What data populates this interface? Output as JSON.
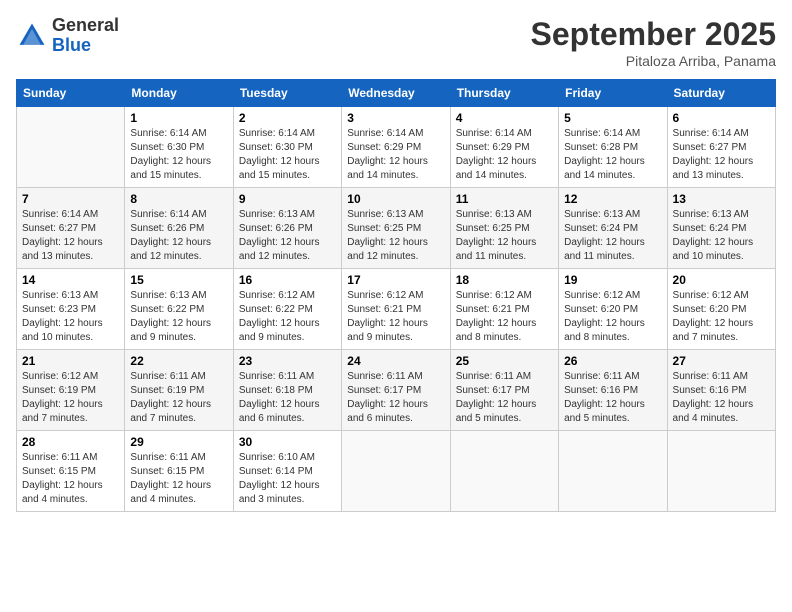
{
  "header": {
    "logo_general": "General",
    "logo_blue": "Blue",
    "month_title": "September 2025",
    "location": "Pitaloza Arriba, Panama"
  },
  "days_of_week": [
    "Sunday",
    "Monday",
    "Tuesday",
    "Wednesday",
    "Thursday",
    "Friday",
    "Saturday"
  ],
  "weeks": [
    [
      {
        "day": "",
        "sunrise": "",
        "sunset": "",
        "daylight": ""
      },
      {
        "day": "1",
        "sunrise": "Sunrise: 6:14 AM",
        "sunset": "Sunset: 6:30 PM",
        "daylight": "Daylight: 12 hours and 15 minutes."
      },
      {
        "day": "2",
        "sunrise": "Sunrise: 6:14 AM",
        "sunset": "Sunset: 6:30 PM",
        "daylight": "Daylight: 12 hours and 15 minutes."
      },
      {
        "day": "3",
        "sunrise": "Sunrise: 6:14 AM",
        "sunset": "Sunset: 6:29 PM",
        "daylight": "Daylight: 12 hours and 14 minutes."
      },
      {
        "day": "4",
        "sunrise": "Sunrise: 6:14 AM",
        "sunset": "Sunset: 6:29 PM",
        "daylight": "Daylight: 12 hours and 14 minutes."
      },
      {
        "day": "5",
        "sunrise": "Sunrise: 6:14 AM",
        "sunset": "Sunset: 6:28 PM",
        "daylight": "Daylight: 12 hours and 14 minutes."
      },
      {
        "day": "6",
        "sunrise": "Sunrise: 6:14 AM",
        "sunset": "Sunset: 6:27 PM",
        "daylight": "Daylight: 12 hours and 13 minutes."
      }
    ],
    [
      {
        "day": "7",
        "sunrise": "Sunrise: 6:14 AM",
        "sunset": "Sunset: 6:27 PM",
        "daylight": "Daylight: 12 hours and 13 minutes."
      },
      {
        "day": "8",
        "sunrise": "Sunrise: 6:14 AM",
        "sunset": "Sunset: 6:26 PM",
        "daylight": "Daylight: 12 hours and 12 minutes."
      },
      {
        "day": "9",
        "sunrise": "Sunrise: 6:13 AM",
        "sunset": "Sunset: 6:26 PM",
        "daylight": "Daylight: 12 hours and 12 minutes."
      },
      {
        "day": "10",
        "sunrise": "Sunrise: 6:13 AM",
        "sunset": "Sunset: 6:25 PM",
        "daylight": "Daylight: 12 hours and 12 minutes."
      },
      {
        "day": "11",
        "sunrise": "Sunrise: 6:13 AM",
        "sunset": "Sunset: 6:25 PM",
        "daylight": "Daylight: 12 hours and 11 minutes."
      },
      {
        "day": "12",
        "sunrise": "Sunrise: 6:13 AM",
        "sunset": "Sunset: 6:24 PM",
        "daylight": "Daylight: 12 hours and 11 minutes."
      },
      {
        "day": "13",
        "sunrise": "Sunrise: 6:13 AM",
        "sunset": "Sunset: 6:24 PM",
        "daylight": "Daylight: 12 hours and 10 minutes."
      }
    ],
    [
      {
        "day": "14",
        "sunrise": "Sunrise: 6:13 AM",
        "sunset": "Sunset: 6:23 PM",
        "daylight": "Daylight: 12 hours and 10 minutes."
      },
      {
        "day": "15",
        "sunrise": "Sunrise: 6:13 AM",
        "sunset": "Sunset: 6:22 PM",
        "daylight": "Daylight: 12 hours and 9 minutes."
      },
      {
        "day": "16",
        "sunrise": "Sunrise: 6:12 AM",
        "sunset": "Sunset: 6:22 PM",
        "daylight": "Daylight: 12 hours and 9 minutes."
      },
      {
        "day": "17",
        "sunrise": "Sunrise: 6:12 AM",
        "sunset": "Sunset: 6:21 PM",
        "daylight": "Daylight: 12 hours and 9 minutes."
      },
      {
        "day": "18",
        "sunrise": "Sunrise: 6:12 AM",
        "sunset": "Sunset: 6:21 PM",
        "daylight": "Daylight: 12 hours and 8 minutes."
      },
      {
        "day": "19",
        "sunrise": "Sunrise: 6:12 AM",
        "sunset": "Sunset: 6:20 PM",
        "daylight": "Daylight: 12 hours and 8 minutes."
      },
      {
        "day": "20",
        "sunrise": "Sunrise: 6:12 AM",
        "sunset": "Sunset: 6:20 PM",
        "daylight": "Daylight: 12 hours and 7 minutes."
      }
    ],
    [
      {
        "day": "21",
        "sunrise": "Sunrise: 6:12 AM",
        "sunset": "Sunset: 6:19 PM",
        "daylight": "Daylight: 12 hours and 7 minutes."
      },
      {
        "day": "22",
        "sunrise": "Sunrise: 6:11 AM",
        "sunset": "Sunset: 6:19 PM",
        "daylight": "Daylight: 12 hours and 7 minutes."
      },
      {
        "day": "23",
        "sunrise": "Sunrise: 6:11 AM",
        "sunset": "Sunset: 6:18 PM",
        "daylight": "Daylight: 12 hours and 6 minutes."
      },
      {
        "day": "24",
        "sunrise": "Sunrise: 6:11 AM",
        "sunset": "Sunset: 6:17 PM",
        "daylight": "Daylight: 12 hours and 6 minutes."
      },
      {
        "day": "25",
        "sunrise": "Sunrise: 6:11 AM",
        "sunset": "Sunset: 6:17 PM",
        "daylight": "Daylight: 12 hours and 5 minutes."
      },
      {
        "day": "26",
        "sunrise": "Sunrise: 6:11 AM",
        "sunset": "Sunset: 6:16 PM",
        "daylight": "Daylight: 12 hours and 5 minutes."
      },
      {
        "day": "27",
        "sunrise": "Sunrise: 6:11 AM",
        "sunset": "Sunset: 6:16 PM",
        "daylight": "Daylight: 12 hours and 4 minutes."
      }
    ],
    [
      {
        "day": "28",
        "sunrise": "Sunrise: 6:11 AM",
        "sunset": "Sunset: 6:15 PM",
        "daylight": "Daylight: 12 hours and 4 minutes."
      },
      {
        "day": "29",
        "sunrise": "Sunrise: 6:11 AM",
        "sunset": "Sunset: 6:15 PM",
        "daylight": "Daylight: 12 hours and 4 minutes."
      },
      {
        "day": "30",
        "sunrise": "Sunrise: 6:10 AM",
        "sunset": "Sunset: 6:14 PM",
        "daylight": "Daylight: 12 hours and 3 minutes."
      },
      {
        "day": "",
        "sunrise": "",
        "sunset": "",
        "daylight": ""
      },
      {
        "day": "",
        "sunrise": "",
        "sunset": "",
        "daylight": ""
      },
      {
        "day": "",
        "sunrise": "",
        "sunset": "",
        "daylight": ""
      },
      {
        "day": "",
        "sunrise": "",
        "sunset": "",
        "daylight": ""
      }
    ]
  ]
}
